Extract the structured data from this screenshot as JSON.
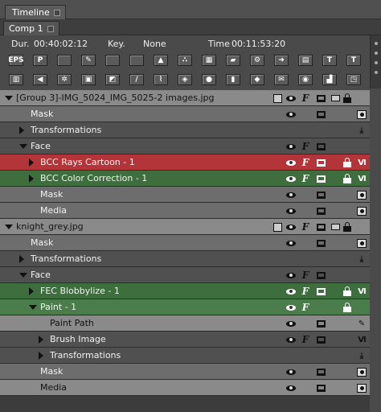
{
  "window": {
    "tab": "Timeline"
  },
  "comp": {
    "tab": "Comp 1"
  },
  "info": {
    "dur_label": "Dur.",
    "dur_value": "00:40:02:12",
    "key_label": "Key.",
    "key_value": "None",
    "time_label": "Time",
    "time_value": "00:11:53:20"
  },
  "toolbar1": [
    {
      "icon": "eps-icon",
      "text": "EPS"
    },
    {
      "icon": "p-icon",
      "text": "P"
    },
    {
      "icon": "rounded-rect-icon",
      "text": ""
    },
    {
      "icon": "pen-icon",
      "text": "✎"
    },
    {
      "icon": "rectangle-icon",
      "text": ""
    },
    {
      "icon": "gradient-icon",
      "text": ""
    },
    {
      "icon": "cone-icon",
      "text": "▲"
    },
    {
      "icon": "particles-icon",
      "text": "∴"
    },
    {
      "icon": "filmstrip-icon",
      "text": "▦"
    },
    {
      "icon": "folder-icon",
      "text": "▰"
    },
    {
      "icon": "folder-gear-icon",
      "text": "⚙"
    },
    {
      "icon": "folder-arrow-icon",
      "text": "➜"
    },
    {
      "icon": "book-icon",
      "text": "▤"
    },
    {
      "icon": "text-italic-icon",
      "text": "T"
    },
    {
      "icon": "text-bold-icon",
      "text": "T"
    }
  ],
  "toolbar2": [
    {
      "icon": "bar-level-icon",
      "text": "▥"
    },
    {
      "icon": "audio-icon",
      "text": "◀"
    },
    {
      "icon": "wheel-icon",
      "text": "✲"
    },
    {
      "icon": "dots-box-icon",
      "text": "▣"
    },
    {
      "icon": "crop-icon",
      "text": "◩"
    },
    {
      "icon": "pencil-icon",
      "text": "/"
    },
    {
      "icon": "brush-icon",
      "text": "⌇"
    },
    {
      "icon": "cube-icon",
      "text": "◈"
    },
    {
      "icon": "sphere-icon",
      "text": "●"
    },
    {
      "icon": "cylinder-icon",
      "text": "▮"
    },
    {
      "icon": "diamond-icon",
      "text": "◆"
    },
    {
      "icon": "mail-icon",
      "text": "✉"
    },
    {
      "icon": "record-icon",
      "text": "◉"
    },
    {
      "icon": "histogram-icon",
      "text": "▟"
    },
    {
      "icon": "corner-icon",
      "text": "◳"
    }
  ],
  "rows": [
    {
      "label": "[Group 3]-IMG_5024_IMG_5025-2 images.jpg",
      "kind": "hdr",
      "indent": 0,
      "toggle": "down",
      "icons": [
        "chk",
        "eye",
        "F",
        "mon",
        "mail",
        "lock"
      ]
    },
    {
      "label": "Mask",
      "kind": "g",
      "indent": 1,
      "toggle": "",
      "icons": [
        "eye",
        "mon",
        "rec"
      ]
    },
    {
      "label": "Transformations",
      "kind": "d",
      "indent": 1,
      "toggle": "right",
      "icons": [
        "trn"
      ]
    },
    {
      "label": "Face",
      "kind": "d",
      "indent": 1,
      "toggle": "down",
      "icons": [
        "eye",
        "F",
        "mon"
      ]
    },
    {
      "label": "BCC Rays Cartoon - 1",
      "kind": "red",
      "indent": 2,
      "toggle": "right",
      "icons": [
        "eye",
        "Fw",
        "mon",
        "lock",
        "VI"
      ]
    },
    {
      "label": "BCC Color Correction - 1",
      "kind": "grn",
      "indent": 2,
      "toggle": "right",
      "icons": [
        "eye",
        "Fw",
        "mon",
        "lock",
        "VI"
      ]
    },
    {
      "label": "Mask",
      "kind": "g",
      "indent": 2,
      "toggle": "",
      "icons": [
        "eye",
        "mon",
        "rec"
      ]
    },
    {
      "label": "Media",
      "kind": "g",
      "indent": 2,
      "toggle": "",
      "icons": [
        "eye",
        "mon",
        "med"
      ]
    },
    {
      "label": "knight_grey.jpg",
      "kind": "hdr",
      "indent": 0,
      "toggle": "down",
      "icons": [
        "chk",
        "eye",
        "F",
        "mon",
        "mail",
        "lock"
      ]
    },
    {
      "label": "Mask",
      "kind": "g",
      "indent": 1,
      "toggle": "",
      "icons": [
        "eye",
        "mon",
        "rec"
      ]
    },
    {
      "label": "Transformations",
      "kind": "d",
      "indent": 1,
      "toggle": "right",
      "icons": [
        "trn"
      ]
    },
    {
      "label": "Face",
      "kind": "d",
      "indent": 1,
      "toggle": "down",
      "icons": [
        "eye",
        "F",
        "mon"
      ]
    },
    {
      "label": "FEC Blobbylize - 1",
      "kind": "grn",
      "indent": 2,
      "toggle": "right",
      "icons": [
        "eye",
        "Fw",
        "mon",
        "lock",
        "VI"
      ]
    },
    {
      "label": "Paint - 1",
      "kind": "gsel",
      "indent": 2,
      "toggle": "down",
      "icons": [
        "eye",
        "Fw",
        "lock"
      ]
    },
    {
      "label": "Paint Path",
      "kind": "hdr",
      "indent": 3,
      "toggle": "",
      "icons": [
        "eye",
        "mon",
        "pen"
      ]
    },
    {
      "label": "Brush Image",
      "kind": "d",
      "indent": 3,
      "toggle": "right",
      "icons": [
        "eye",
        "F",
        "mon",
        "VI"
      ]
    },
    {
      "label": "Transformations",
      "kind": "d",
      "indent": 3,
      "toggle": "right",
      "icons": [
        "trn"
      ]
    },
    {
      "label": "Mask",
      "kind": "g",
      "indent": 2,
      "toggle": "",
      "icons": [
        "eye",
        "mon",
        "rec"
      ]
    },
    {
      "label": "Media",
      "kind": "hdr",
      "indent": 2,
      "toggle": "",
      "icons": [
        "eye",
        "mon",
        "med"
      ]
    }
  ]
}
